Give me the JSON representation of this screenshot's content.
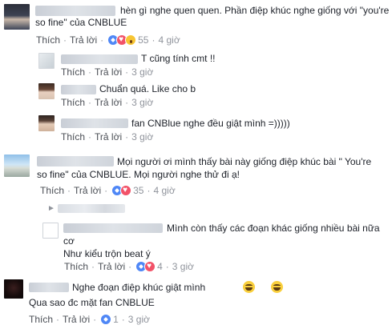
{
  "actions": {
    "like": "Thích",
    "reply": "Trả lời",
    "separator": "·"
  },
  "comments": [
    {
      "text": "hèn gì nghe quen quen. Phần điệp khúc nghe giống với \"you're",
      "text2": "so fine\" của CNBLUE",
      "reactions": "55",
      "time": "4 giờ"
    },
    {
      "text": "T cũng tính cmt !!",
      "time": "3 giờ"
    },
    {
      "text": "Chuẩn quá. Like cho b",
      "time": "3 giờ"
    },
    {
      "text": "fan CNBlue nghe đều giật mình =)))))",
      "time": "3 giờ"
    },
    {
      "text": "Mọi người ơi mình thấy bài này giống điệp khúc bài \" You're",
      "text2": "so fine\" của CNBLUE. Mọi người nghe thử đi ạ!",
      "reactions": "35",
      "time": "4 giờ"
    },
    {
      "text": "Mình còn thấy các đoạn khác giống nhiều bài nữa",
      "text2": "cơ",
      "text3": "Như kiểu trộn beat ý",
      "reactions": "4",
      "time": "3 giờ"
    },
    {
      "text": "Nghe đoạn điệp khúc giật mình",
      "text2": "Qua sao đc mặt fan CNBLUE",
      "reactions": "1",
      "time": "3 giờ"
    }
  ]
}
